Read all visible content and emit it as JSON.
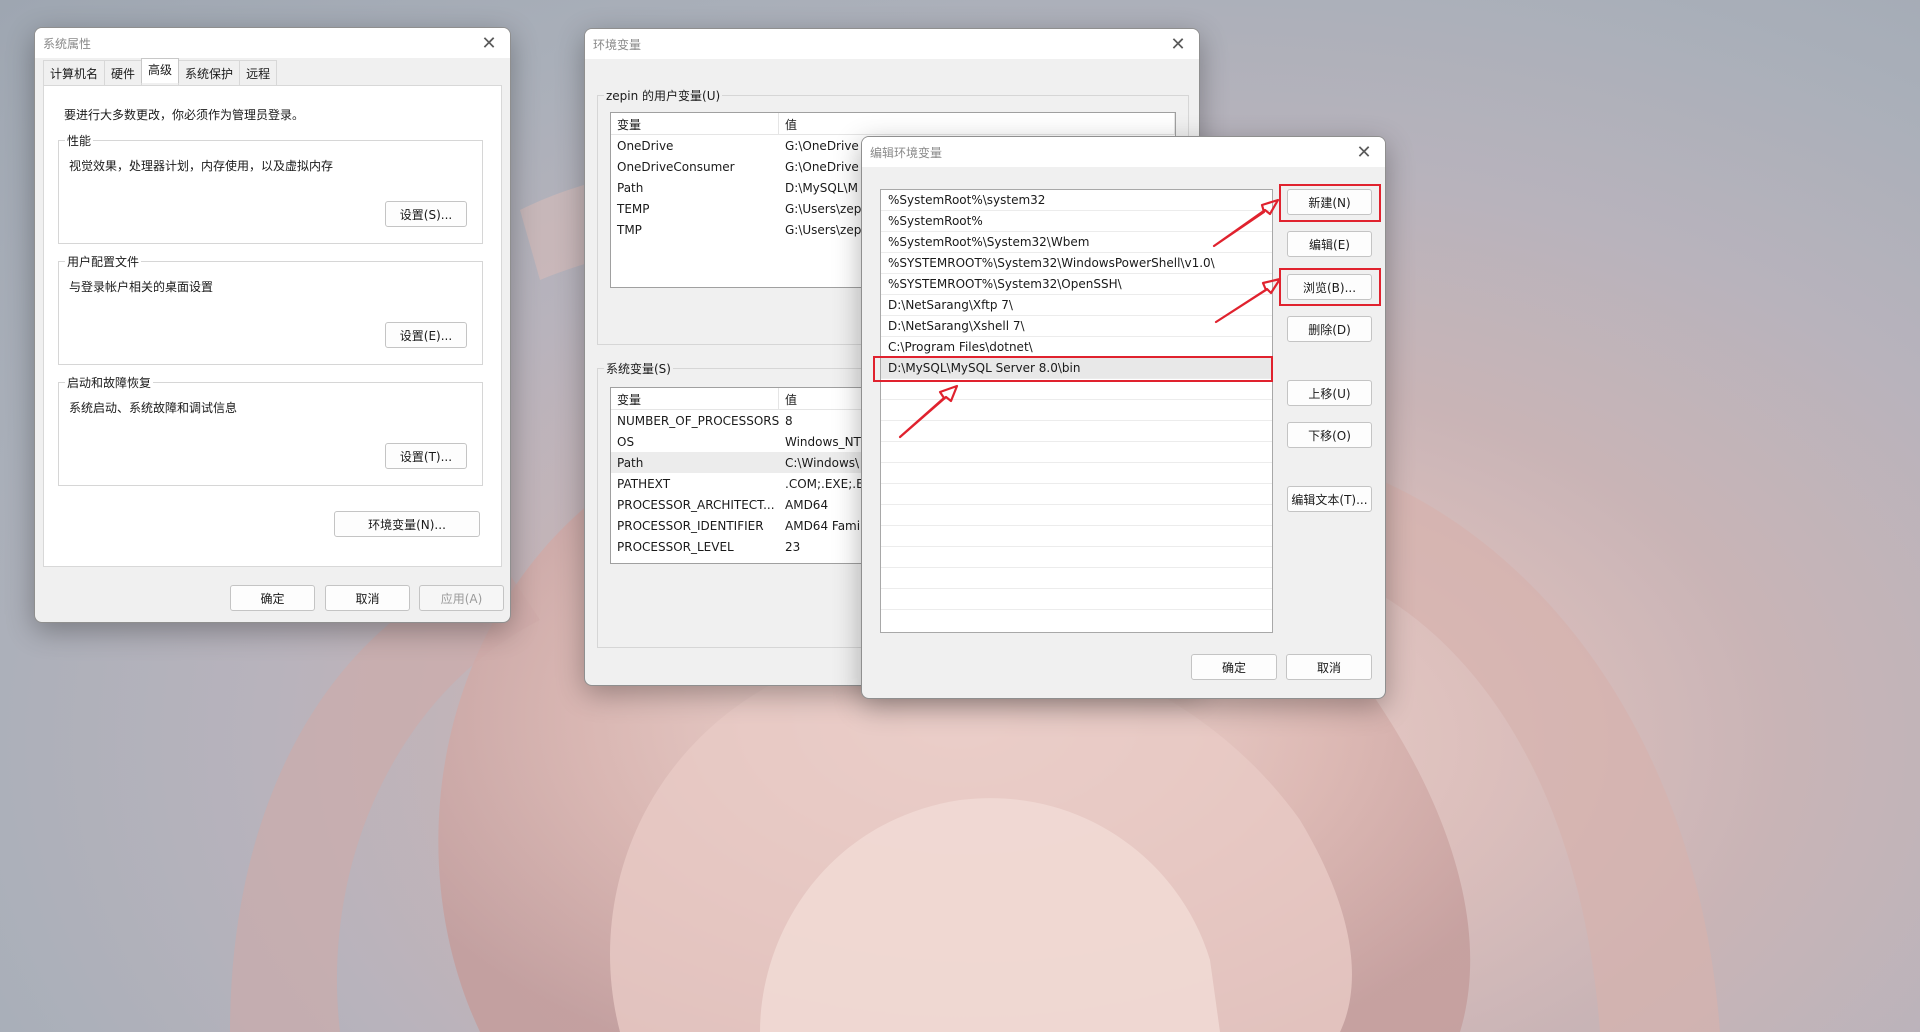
{
  "sys_props": {
    "title": "系统属性",
    "tabs": [
      "计算机名",
      "硬件",
      "高级",
      "系统保护",
      "远程"
    ],
    "admin_notice": "要进行大多数更改，你必须作为管理员登录。",
    "performance": {
      "label": "性能",
      "desc": "视觉效果，处理器计划，内存使用，以及虚拟内存",
      "button": "设置(S)..."
    },
    "user_profiles": {
      "label": "用户配置文件",
      "desc": "与登录帐户相关的桌面设置",
      "button": "设置(E)..."
    },
    "startup_recovery": {
      "label": "启动和故障恢复",
      "desc": "系统启动、系统故障和调试信息",
      "button": "设置(T)..."
    },
    "env_button": "环境变量(N)...",
    "ok": "确定",
    "cancel": "取消",
    "apply": "应用(A)"
  },
  "env_vars": {
    "title": "环境变量",
    "user_section": "zepin 的用户变量(U)",
    "col_var": "变量",
    "col_val": "值",
    "user_vars": [
      {
        "name": "OneDrive",
        "value": "G:\\OneDrive"
      },
      {
        "name": "OneDriveConsumer",
        "value": "G:\\OneDrive"
      },
      {
        "name": "Path",
        "value": "D:\\MySQL\\M"
      },
      {
        "name": "TEMP",
        "value": "G:\\Users\\zep"
      },
      {
        "name": "TMP",
        "value": "G:\\Users\\zep"
      }
    ],
    "system_section": "系统变量(S)",
    "system_vars": [
      {
        "name": "NUMBER_OF_PROCESSORS",
        "value": "8"
      },
      {
        "name": "OS",
        "value": "Windows_NT"
      },
      {
        "name": "Path",
        "value": "C:\\Windows\\"
      },
      {
        "name": "PATHEXT",
        "value": ".COM;.EXE;.B"
      },
      {
        "name": "PROCESSOR_ARCHITECT...",
        "value": "AMD64"
      },
      {
        "name": "PROCESSOR_IDENTIFIER",
        "value": "AMD64 Famil"
      },
      {
        "name": "PROCESSOR_LEVEL",
        "value": "23"
      }
    ]
  },
  "edit_env": {
    "title": "编辑环境变量",
    "paths": [
      "%SystemRoot%\\system32",
      "%SystemRoot%",
      "%SystemRoot%\\System32\\Wbem",
      "%SYSTEMROOT%\\System32\\WindowsPowerShell\\v1.0\\",
      "%SYSTEMROOT%\\System32\\OpenSSH\\",
      "D:\\NetSarang\\Xftp 7\\",
      "D:\\NetSarang\\Xshell 7\\",
      "C:\\Program Files\\dotnet\\",
      "D:\\MySQL\\MySQL Server 8.0\\bin"
    ],
    "selected_index": 8,
    "buttons": {
      "new": "新建(N)",
      "edit": "编辑(E)",
      "browse": "浏览(B)...",
      "delete": "删除(D)",
      "move_up": "上移(U)",
      "move_down": "下移(O)",
      "edit_text": "编辑文本(T)..."
    },
    "ok": "确定",
    "cancel": "取消"
  },
  "colors": {
    "annotation_red": "#e0222e",
    "selection": "#e8e8e8"
  }
}
